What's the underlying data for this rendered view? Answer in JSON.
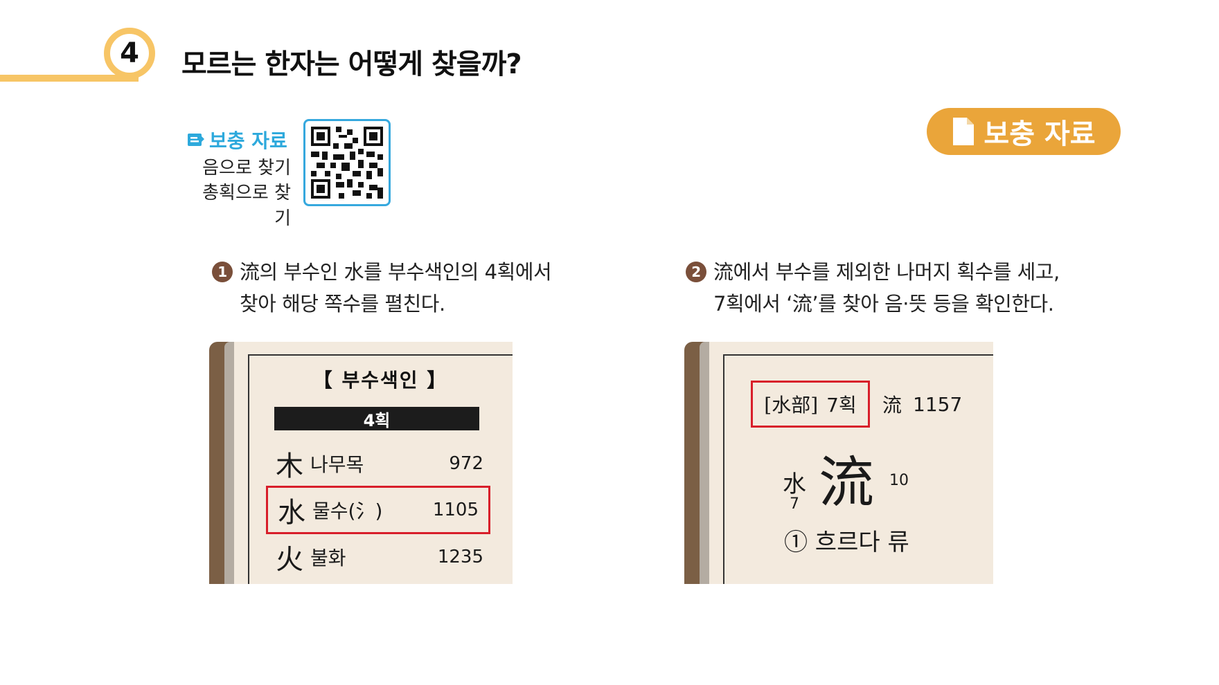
{
  "header": {
    "number": "4",
    "title": "모르는 한자는 어떻게 찾을까?"
  },
  "supplement": {
    "label": "보충 자료",
    "lines": [
      "음으로 찾기",
      "총획으로 찾기"
    ],
    "icon": "document-icon"
  },
  "button": {
    "label": "보충 자료",
    "icon": "document-icon"
  },
  "colors": {
    "accent": "#f7c566",
    "button": "#eaa53a",
    "link": "#2da9dc",
    "step_badge": "#7a4f3a",
    "highlight": "#d81e2a"
  },
  "steps": [
    {
      "num": "1",
      "line1": "流의 부수인 水를 부수색인의 4획에서",
      "line2": "찾아 해당 쪽수를 펼친다."
    },
    {
      "num": "2",
      "line1": "流에서 부수를 제외한 나머지 획수를 세고,",
      "line2": "7획에서 ‘流’를 찾아 음·뜻 등을 확인한다."
    }
  ],
  "book1": {
    "title": "【 부수색인 】",
    "bar": "4획",
    "rows": [
      {
        "hanja": "木",
        "name": "나무목",
        "page": "972"
      },
      {
        "hanja": "水",
        "name": "물수(氵)",
        "page": "1105"
      },
      {
        "hanja": "火",
        "name": "불화",
        "page": "1235"
      }
    ]
  },
  "book2": {
    "radical_label": "[水部]",
    "strokes_label": "7획",
    "entry_hanja": "流",
    "entry_page": "1157",
    "radical_small": "水",
    "radical_strokes": "7",
    "big_hanja": "流",
    "total_strokes": "10",
    "meaning": "① 흐르다 류"
  }
}
